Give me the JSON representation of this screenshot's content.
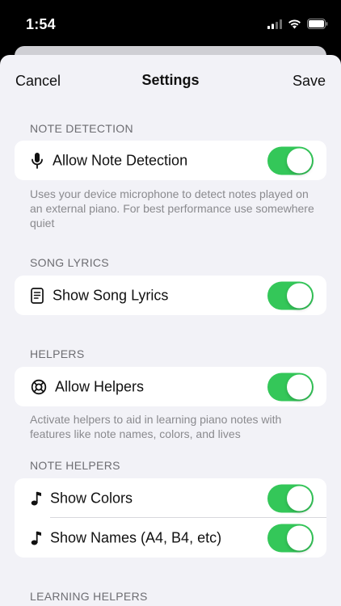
{
  "status_bar": {
    "time": "1:54"
  },
  "nav": {
    "cancel": "Cancel",
    "title": "Settings",
    "save": "Save"
  },
  "sections": {
    "note_detection": {
      "header": "NOTE DETECTION",
      "row": {
        "label": "Allow Note Detection",
        "icon": "microphone-icon",
        "enabled": true
      },
      "footer": "Uses your device microphone to detect notes played on an external piano. For best performance use somewhere quiet"
    },
    "song_lyrics": {
      "header": "SONG LYRICS",
      "row": {
        "label": "Show Song Lyrics",
        "icon": "document-icon",
        "enabled": true
      }
    },
    "helpers": {
      "header": "HELPERS",
      "row": {
        "label": "Allow Helpers",
        "icon": "lifebuoy-icon",
        "enabled": true
      },
      "footer": "Activate helpers to aid in learning piano notes with features like note names, colors, and lives"
    },
    "note_helpers": {
      "header": "NOTE HELPERS",
      "rows": [
        {
          "label": "Show Colors",
          "icon": "music-note-icon",
          "enabled": true
        },
        {
          "label": "Show Names (A4, B4, etc)",
          "icon": "music-note-icon",
          "enabled": true
        }
      ]
    },
    "learning_helpers": {
      "header": "LEARNING HELPERS"
    }
  },
  "colors": {
    "accent_toggle": "#34c759",
    "background": "#f2f2f7"
  }
}
